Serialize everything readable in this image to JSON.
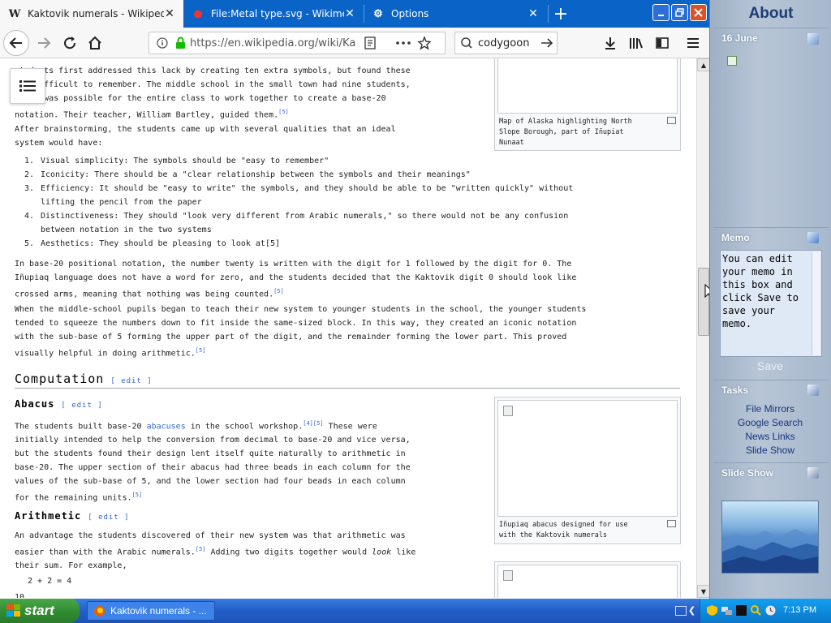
{
  "browser": {
    "tabs": [
      {
        "title": "Kaktovik numerals - Wikipedia",
        "favicon": "wikipedia-W",
        "active": true
      },
      {
        "title": "File:Metal type.svg - Wikimedia Co",
        "favicon": "wikimedia-icon",
        "active": false
      },
      {
        "title": "Options",
        "favicon": "gear-icon",
        "active": false
      }
    ],
    "url": "https://en.wikipedia.org/wiki/Ka",
    "search_value": "codygoon"
  },
  "article": {
    "intro_lines": [
      "students first addressed this lack by creating ten extra symbols, but found these",
      "too difficult to remember. The middle school in the small town had nine students,",
      "so it was possible for the entire class to work together to create a base-20",
      "notation. Their teacher, William Bartley, guided them."
    ],
    "brainstorm_lines": [
      "After brainstorming, the students came up with several qualities that an ideal",
      "system would have:"
    ],
    "qualities": [
      {
        "num": "1.",
        "lines": [
          "Visual simplicity: The symbols should be \"easy to remember\""
        ]
      },
      {
        "num": "2.",
        "lines": [
          "Iconicity: There should be a \"clear relationship between the symbols and their meanings\""
        ]
      },
      {
        "num": "3.",
        "lines": [
          "Efficiency: It should be \"easy to write\" the symbols, and they should be able to be \"written quickly\" without",
          "lifting the pencil from the paper"
        ]
      },
      {
        "num": "4.",
        "lines": [
          "Distinctiveness: They should \"look very different from Arabic numerals,\" so there would not be any confusion",
          "between notation in the two systems"
        ]
      },
      {
        "num": "5.",
        "lines": [
          "Aesthetics: They should be pleasing to look at"
        ]
      }
    ],
    "base20_lines": [
      "In base-20 positional notation, the number twenty is written with the digit for 1 followed by the digit for 0. The",
      "Iñupiaq language does not have a word for zero, and the students decided that the Kaktovik digit 0 should look like",
      "crossed arms, meaning that nothing was being counted."
    ],
    "teach_lines": [
      "When the middle-school pupils began to teach their new system to younger students in the school, the younger students",
      "tended to squeeze the numbers down to fit inside the same-sized block. In this way, they created an iconic notation",
      "with the sub-base of 5 forming the upper part of the digit, and the remainder forming the lower part. This proved",
      "visually helpful in doing arithmetic."
    ],
    "ref5": "[5]",
    "ref4": "[4]",
    "computation_heading": "Computation",
    "edit_label": "[ edit ]",
    "abacus_heading": "Abacus",
    "abacus_lines": [
      {
        "before": "The students built base-20 ",
        "link": "abacuses",
        "after": " in the school workshop."
      },
      {
        "before": "initially intended to help the conversion from decimal to base-20 and vice versa,",
        "link": "",
        "after": ""
      },
      {
        "before": "but the students found their design lent itself quite naturally to arithmetic in",
        "link": "",
        "after": ""
      },
      {
        "before": "base-20. The upper section of their abacus had three beads in each column for the",
        "link": "",
        "after": ""
      },
      {
        "before": "values of the sub-base of 5, and the lower section had four beads in each column",
        "link": "",
        "after": ""
      },
      {
        "before": "for the remaining units.",
        "link": "",
        "after": ""
      }
    ],
    "abacus_these_were": " These were",
    "arithmetic_heading": "Arithmetic",
    "arithmetic_line1": "An advantage the students discovered of their new system was that arithmetic was",
    "arithmetic_line2": "easier than with the Arabic numerals.",
    "arithmetic_line2b": " Adding two digits together would ",
    "arithmetic_look": "look",
    "arithmetic_line2c": " like",
    "arithmetic_line3": "their sum. For example,",
    "equation": "2 + 2 = 4",
    "cutoff_text": "10",
    "figure_map_caption": [
      "Map of Alaska highlighting North",
      "Slope Borough, part of Iñupiat",
      "Nunaat"
    ],
    "figure_abacus_caption": [
      "Iñupiaq abacus designed for use",
      "with the Kaktovik numerals"
    ]
  },
  "sidebar": {
    "title": "About",
    "date": "16 June",
    "memo_header": "Memo",
    "memo_text": "You can edit your memo in this box and click Save to save your memo.",
    "save_label": "Save",
    "tasks_header": "Tasks",
    "tasks": [
      "File Mirrors",
      "Google Search",
      "News Links",
      "Slide Show"
    ],
    "slideshow_header": "Slide Show"
  },
  "taskbar": {
    "start_label": "start",
    "task_item": "Kaktovik numerals - ...",
    "clock": "7:13 PM"
  },
  "colors": {
    "firefox_tabbar": "#0a64c8",
    "link": "#3366cc",
    "xp_taskbar": "#2461c9",
    "xp_start": "#2f8a2f"
  }
}
